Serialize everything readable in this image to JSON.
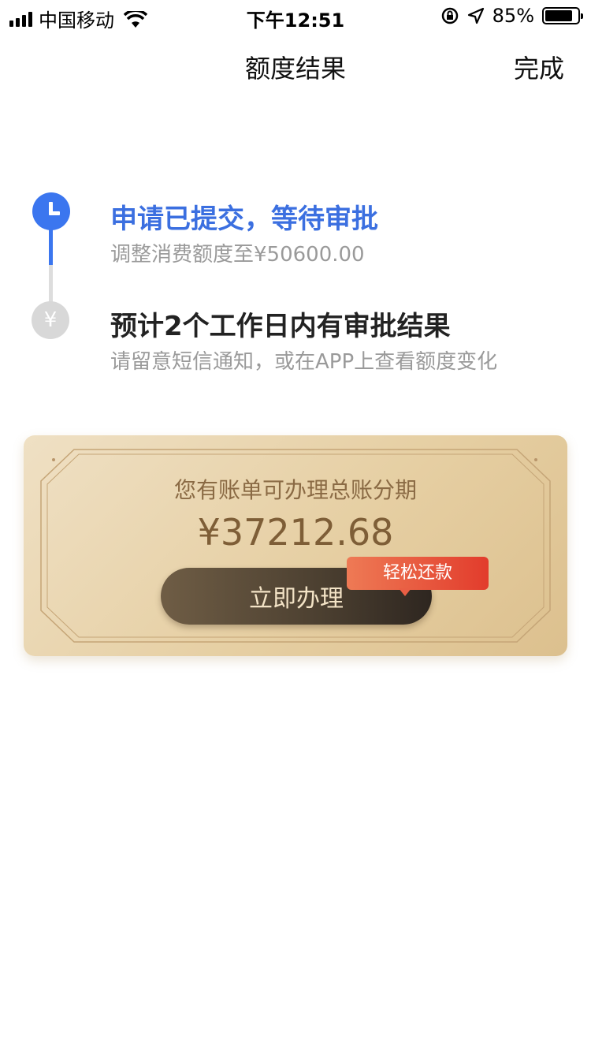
{
  "status_bar": {
    "carrier": "中国移动",
    "time": "下午12:51",
    "battery_percent": "85%",
    "battery_level": 0.85,
    "icons": [
      "signal-icon",
      "wifi-icon",
      "orientation-lock-icon",
      "location-arrow-icon",
      "battery-icon"
    ]
  },
  "nav": {
    "title": "额度结果",
    "done_label": "完成"
  },
  "timeline": {
    "step1": {
      "title": "申请已提交，等待审批",
      "subtitle": "调整消费额度至¥50600.00",
      "icon": "clock-icon",
      "color": "#3b76ef"
    },
    "step2": {
      "title": "预计2个工作日内有审批结果",
      "subtitle": "请留意短信通知，或在APP上查看额度变化",
      "icon_glyph": "¥",
      "icon": "yen-icon"
    }
  },
  "promo": {
    "title": "您有账单可办理总账分期",
    "amount": "¥37212.68",
    "button_label": "立即办理",
    "badge_label": "轻松还款"
  }
}
